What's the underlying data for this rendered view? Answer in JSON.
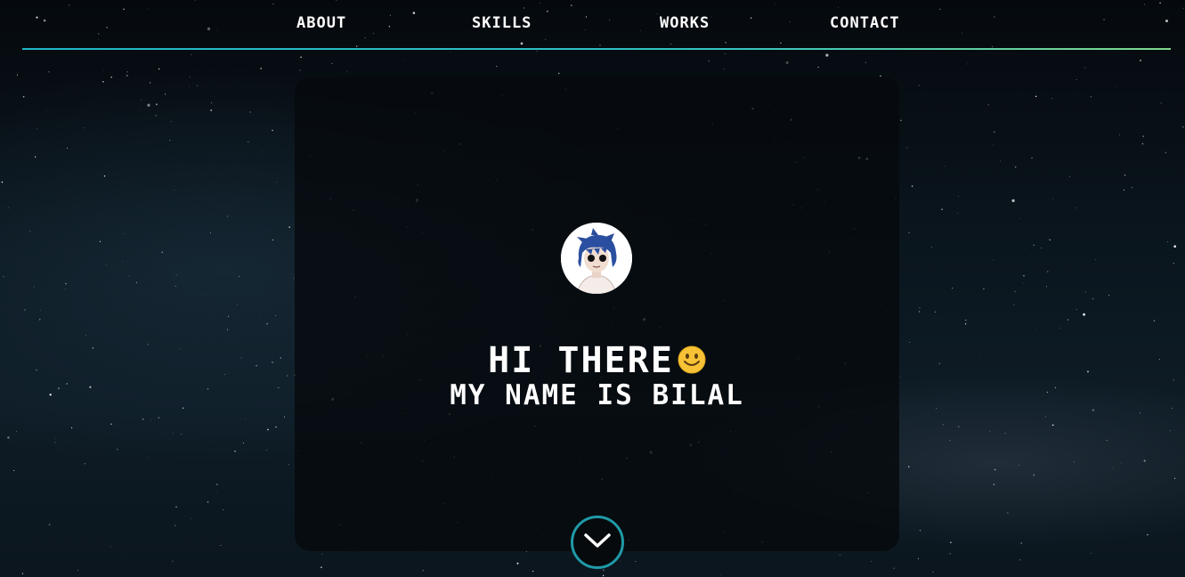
{
  "nav": {
    "items": [
      {
        "label": "ABOUT"
      },
      {
        "label": "SKILLS"
      },
      {
        "label": "WORKS"
      },
      {
        "label": "CONTACT"
      }
    ],
    "underline_color_start": "#1fb6c8",
    "underline_color_end": "#7fd98d"
  },
  "hero": {
    "avatar_icon": "anime-avatar-icon",
    "title": "HI THERE",
    "title_emoji_icon": "smiling-face-emoji-icon",
    "subtitle": "MY NAME IS BILAL",
    "scroll_icon": "chevron-down-icon",
    "accent_color": "#1f9aa8"
  }
}
